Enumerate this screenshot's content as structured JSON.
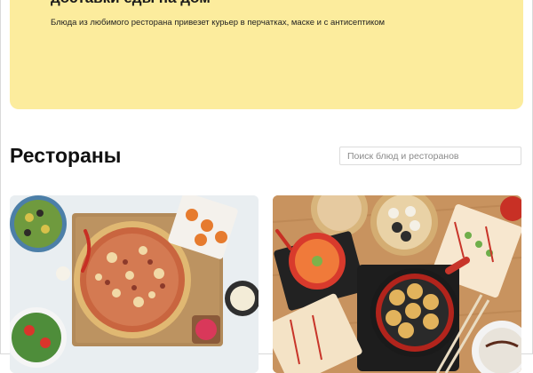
{
  "hero": {
    "title": "доставки еды на дом",
    "subtitle": "Блюда из любимого ресторана привезет курьер в перчатках, маске и с антисептиком"
  },
  "restaurants": {
    "title": "Рестораны",
    "search_placeholder": "Поиск блюд и ресторанов"
  },
  "cards": [
    {
      "image": "pizza-photo"
    },
    {
      "image": "asian-dishes-photo"
    }
  ]
}
